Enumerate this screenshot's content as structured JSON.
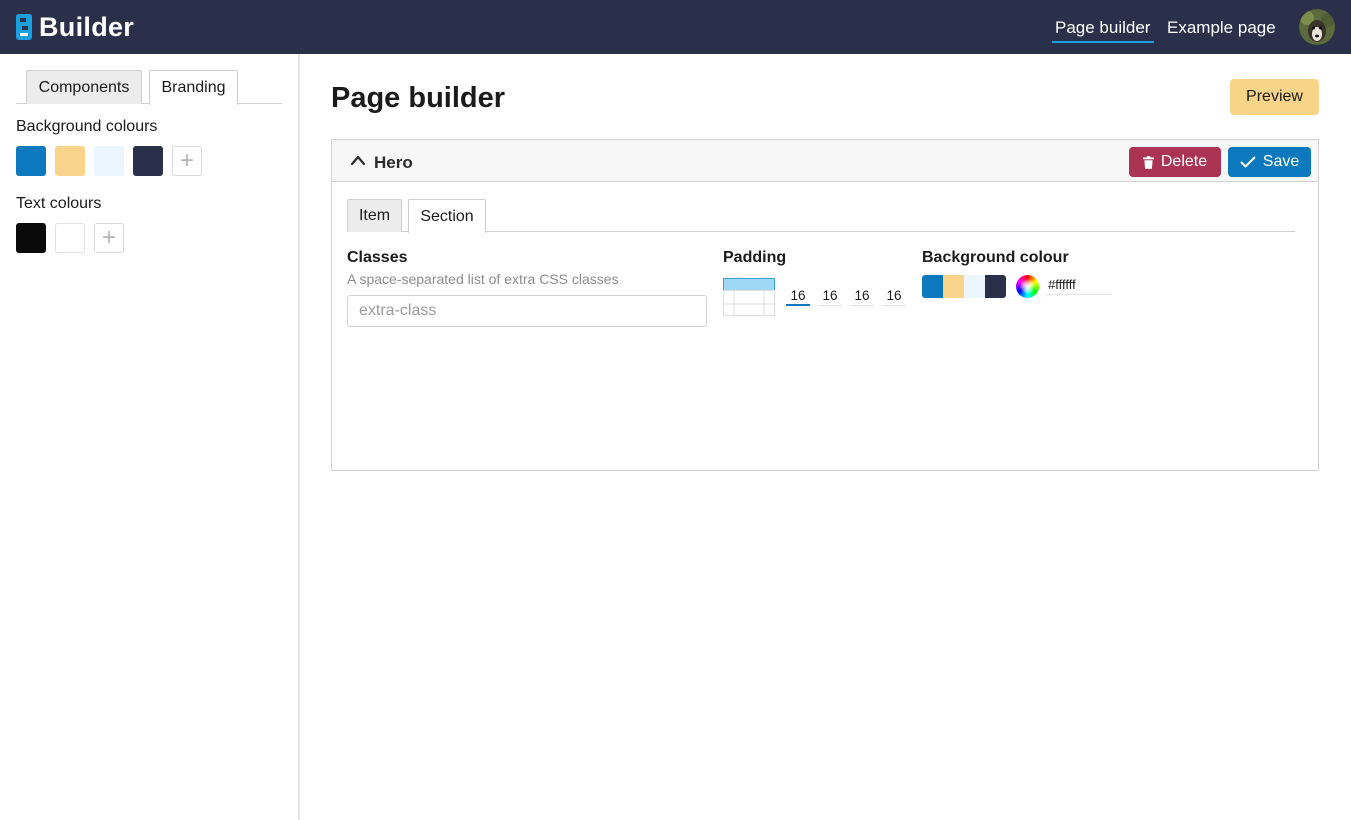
{
  "app": {
    "name": "Builder",
    "nav": [
      {
        "label": "Page builder",
        "active": true
      },
      {
        "label": "Example page",
        "active": false
      }
    ],
    "accent": "#2a3049"
  },
  "sidebar": {
    "tabs": [
      {
        "label": "Components",
        "active": false
      },
      {
        "label": "Branding",
        "active": true
      }
    ],
    "background_colours_label": "Background colours",
    "background_colours": [
      "#0c78bd",
      "#f9d48a",
      "#eaf5fd",
      "#2a3049"
    ],
    "text_colours_label": "Text colours",
    "text_colours": [
      "#0a0a0a",
      "#ffffff"
    ],
    "add_icon": "plus-icon"
  },
  "main": {
    "title": "Page builder",
    "preview_label": "Preview",
    "panel": {
      "title": "Hero",
      "collapse_icon": "chevron-up-icon",
      "delete_label": "Delete",
      "delete_icon": "trash-icon",
      "save_label": "Save",
      "save_icon": "check-icon",
      "tabs": [
        {
          "label": "Item",
          "active": true
        },
        {
          "label": "Section",
          "active": false
        }
      ],
      "classes": {
        "label": "Classes",
        "help": "A space-separated list of extra CSS classes",
        "placeholder": "extra-class",
        "value": ""
      },
      "padding": {
        "label": "Padding",
        "values": [
          "16",
          "16",
          "16",
          "16"
        ]
      },
      "background": {
        "label": "Background colour",
        "swatches": [
          "#0c78bd",
          "#f9d48a",
          "#eaf5fd",
          "#2a3049"
        ],
        "hex": "#ffffff"
      }
    }
  },
  "colors": {
    "delete": "#ab3454",
    "save": "#0c78bd",
    "preview": "#f7d488"
  }
}
